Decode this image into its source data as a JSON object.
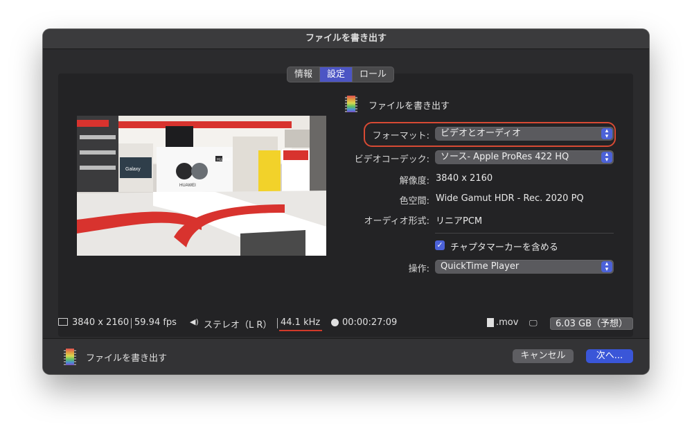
{
  "window": {
    "title": "ファイルを書き出す",
    "tabs": [
      {
        "label": "情報",
        "active": false
      },
      {
        "label": "設定",
        "active": true
      },
      {
        "label": "ロール",
        "active": false
      }
    ]
  },
  "settings": {
    "header": "ファイルを書き出す",
    "format": {
      "label": "フォーマット:",
      "value": "ビデオとオーディオ"
    },
    "video_codec": {
      "label": "ビデオコーデック:",
      "value": "ソース- Apple ProRes 422 HQ"
    },
    "resolution": {
      "label": "解像度:",
      "value": "3840 x 2160"
    },
    "color_space": {
      "label": "色空間:",
      "value": "Wide Gamut HDR - Rec. 2020 PQ"
    },
    "audio_format": {
      "label": "オーディオ形式:",
      "value": "リニアPCM"
    },
    "chapter_markers": {
      "label": "チャプタマーカーを含める",
      "checked": true
    },
    "action": {
      "label": "操作:",
      "value": "QuickTime Player"
    }
  },
  "preview": {
    "brand_left": "Galaxy",
    "brand_center": "HUAWEI",
    "brand_right": "HUAWEI"
  },
  "status": {
    "resolution": "3840 x 2160",
    "fps": "59.94 fps",
    "audio": "ステレオ（L R）",
    "sample_rate": "44.1 kHz",
    "duration": "00:00:27:09",
    "extension": ".mov",
    "size": "6.03 GB（予想）"
  },
  "footer": {
    "label": "ファイルを書き出す",
    "cancel": "キャンセル",
    "next": "次へ..."
  },
  "colors": {
    "accent": "#4c62d8",
    "highlight_ring": "#d84a34"
  }
}
